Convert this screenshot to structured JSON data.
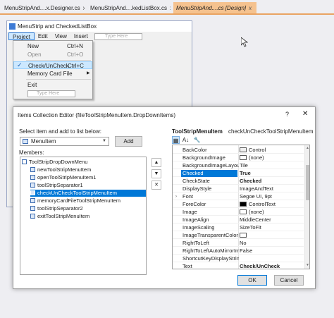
{
  "ide_tabs": [
    {
      "label": "MenuStripAnd....x.Designer.cs",
      "close": "x"
    },
    {
      "label": "MenuStripAnd....kedListBox.cs",
      "close": "x"
    },
    {
      "label": "MenuStripAnd....cs [Design]",
      "close": "x"
    }
  ],
  "form": {
    "title": "MenuStrip and CheckedListBox",
    "menus": [
      "Project",
      "Edit",
      "View",
      "Insert"
    ],
    "type_here": "Type Here"
  },
  "dropdown": {
    "items": [
      {
        "label": "New",
        "shortcut": "Ctrl+N"
      },
      {
        "label": "Open",
        "shortcut": "Ctrl+O"
      },
      {
        "label": "Check/UnCheck",
        "shortcut": "Ctrl+C",
        "check": "✓"
      },
      {
        "label": "Memory Card File",
        "arrow": "▶"
      },
      {
        "label": "Exit"
      }
    ],
    "type_here": "Type Here"
  },
  "dialog": {
    "title": "Items Collection Editor (fileToolStripMenuItem.DropDownItems)",
    "help": "?",
    "close": "✕",
    "select_label": "Select item and add to list below:",
    "combo_value": "MenuItem",
    "combo_arrow": "▼",
    "add_label": "Add",
    "members_label": "Members:",
    "members": [
      "ToolStripDropDownMenu",
      "newToolStripMenuItem",
      "openToolStripMenuItem1",
      "toolStripSeparator1",
      "checkUnCheckToolStripMenuItem",
      "memoryCardFileToolStripMenuItem",
      "toolStripSeparator2",
      "exitToolStripMenuItem"
    ],
    "side_buttons": {
      "up": "▲",
      "down": "▼",
      "delete": "✕"
    },
    "prop_title": "ToolStripMenuItem",
    "prop_name": "checkUnCheckToolStripMenuItem",
    "toolbar": {
      "categorized": "▦",
      "alphabetical": "A↓",
      "pages": "🔧"
    },
    "properties": [
      {
        "name": "BackColor",
        "value": "Control",
        "swatch": "#f0f0f0"
      },
      {
        "name": "BackgroundImage",
        "value": "(none)",
        "swatch": "#ffffff"
      },
      {
        "name": "BackgroundImageLayout",
        "value": "Tile"
      },
      {
        "name": "Checked",
        "value": "True",
        "bold": true
      },
      {
        "name": "CheckState",
        "value": "Checked",
        "bold": true
      },
      {
        "name": "DisplayStyle",
        "value": "ImageAndText"
      },
      {
        "name": "Font",
        "value": "Segoe UI, 9pt",
        "expand": "›"
      },
      {
        "name": "ForeColor",
        "value": "ControlText",
        "swatch": "#000000"
      },
      {
        "name": "Image",
        "value": "(none)",
        "swatch": "#ffffff"
      },
      {
        "name": "ImageAlign",
        "value": "MiddleCenter"
      },
      {
        "name": "ImageScaling",
        "value": "SizeToFit"
      },
      {
        "name": "ImageTransparentColor",
        "value": "",
        "swatch": "#ffffff"
      },
      {
        "name": "RightToLeft",
        "value": "No"
      },
      {
        "name": "RightToLeftAutoMirrorIma",
        "value": "False"
      },
      {
        "name": "ShortcutKeyDisplayString",
        "value": ""
      },
      {
        "name": "Text",
        "value": "Check/UnCheck",
        "bold": true
      }
    ],
    "scroll": {
      "up": "▲",
      "down": "▼"
    },
    "ok_label": "OK",
    "cancel_label": "Cancel"
  },
  "colors": {
    "accent": "#0078d7",
    "active_tab": "#f5c28f",
    "selection": "#0078d7"
  }
}
